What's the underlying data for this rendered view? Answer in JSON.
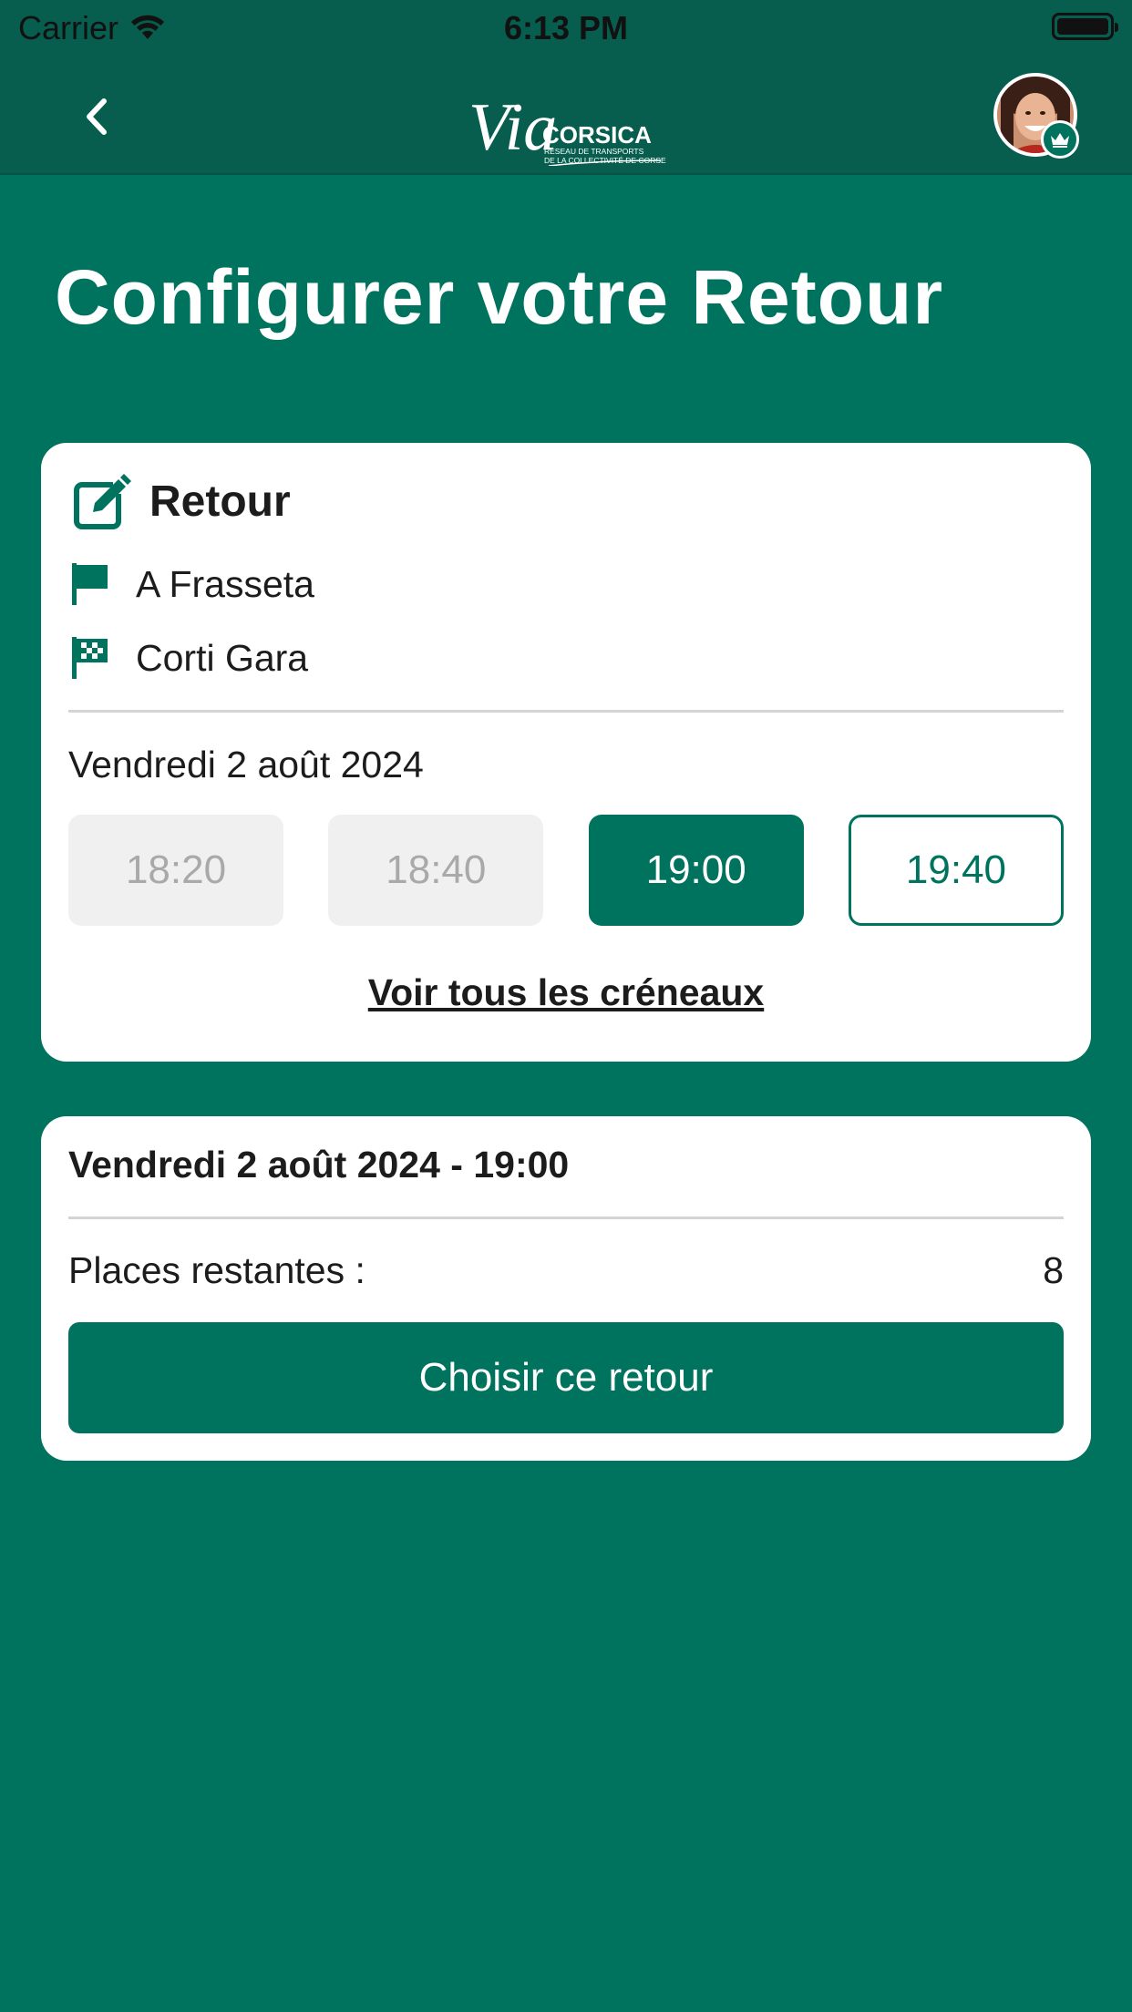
{
  "status_bar": {
    "carrier": "Carrier",
    "time": "6:13 PM"
  },
  "nav": {
    "back_icon": "chevron-left-icon",
    "logo_icon": "via-corsica-logo",
    "logo": {
      "word_via": "Via",
      "word_corsica": "CORSICA",
      "tagline_1": "RÉSEAU DE TRANSPORTS",
      "tagline_2": "DE LA COLLECTIVITÉ DE CORSE"
    },
    "avatar_badge_icon": "crown-icon"
  },
  "page": {
    "title": "Configurer votre Retour"
  },
  "trip": {
    "header_icon": "edit-icon",
    "header": "Retour",
    "origin_icon": "flag-icon",
    "origin": "A Frasseta",
    "destination_icon": "checkered-flag-icon",
    "destination": "Corti Gara",
    "date": "Vendredi 2 août 2024",
    "slots": [
      {
        "time": "18:20",
        "state": "disabled"
      },
      {
        "time": "18:40",
        "state": "disabled"
      },
      {
        "time": "19:00",
        "state": "selected"
      },
      {
        "time": "19:40",
        "state": "available"
      }
    ],
    "see_all_label": "Voir tous les créneaux"
  },
  "summary": {
    "title": "Vendredi 2 août 2024 - 19:00",
    "places_label": "Places restantes :",
    "places_value": "8",
    "choose_label": "Choisir ce retour"
  },
  "colors": {
    "primary": "#00735f",
    "header": "#075e4e",
    "disabled_bg": "#f0f0f0",
    "disabled_text": "#a9a9a9"
  }
}
